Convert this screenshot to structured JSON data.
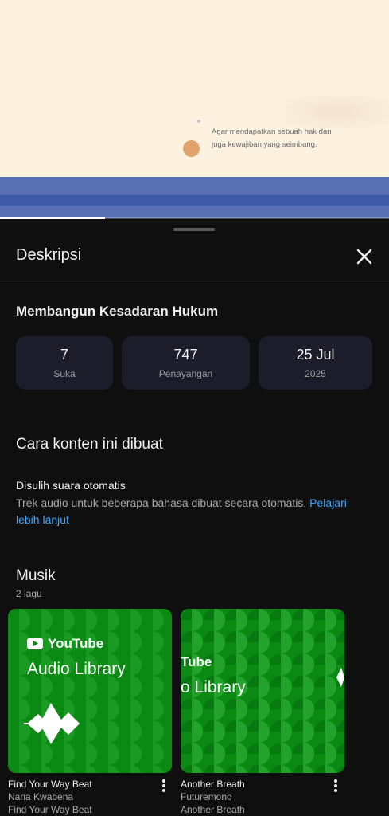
{
  "video": {
    "caption_line1": "Agar mendapatkan sebuah hak dan",
    "caption_line2": "juga kewajiban yang seimbang.",
    "progress_fraction": 0.27
  },
  "sheet": {
    "title": "Deskripsi",
    "close_icon": "close-icon",
    "video_title": "Membangun Kesadaran Hukum",
    "stats": [
      {
        "value": "7",
        "label": "Suka"
      },
      {
        "value": "747",
        "label": "Penayangan"
      },
      {
        "value": "25 Jul",
        "label": "2025"
      }
    ],
    "how_made": {
      "heading": "Cara konten ini dibuat",
      "item_title": "Disulih suara otomatis",
      "item_desc": "Trek audio untuk beberapa bahasa dibuat secara otomatis.",
      "learn_more": "Pelajari lebih lanjut"
    },
    "music": {
      "heading": "Musik",
      "count": "2 lagu",
      "tracks": [
        {
          "title": "Find Your Way Beat",
          "artist": "Nana Kwabena",
          "album": "Find Your Way Beat",
          "art_brand": "YouTube",
          "art_label": "Audio Library"
        },
        {
          "title": "Another Breath",
          "artist": "Futuremono",
          "album": "Another Breath",
          "art_brand": "Tube",
          "art_label": "o Library"
        }
      ]
    }
  },
  "colors": {
    "sheet_bg": "#0f0f0f",
    "stat_bg": "#1c1c2b",
    "link": "#3ea6ff",
    "card_green": "#0a8a12"
  }
}
